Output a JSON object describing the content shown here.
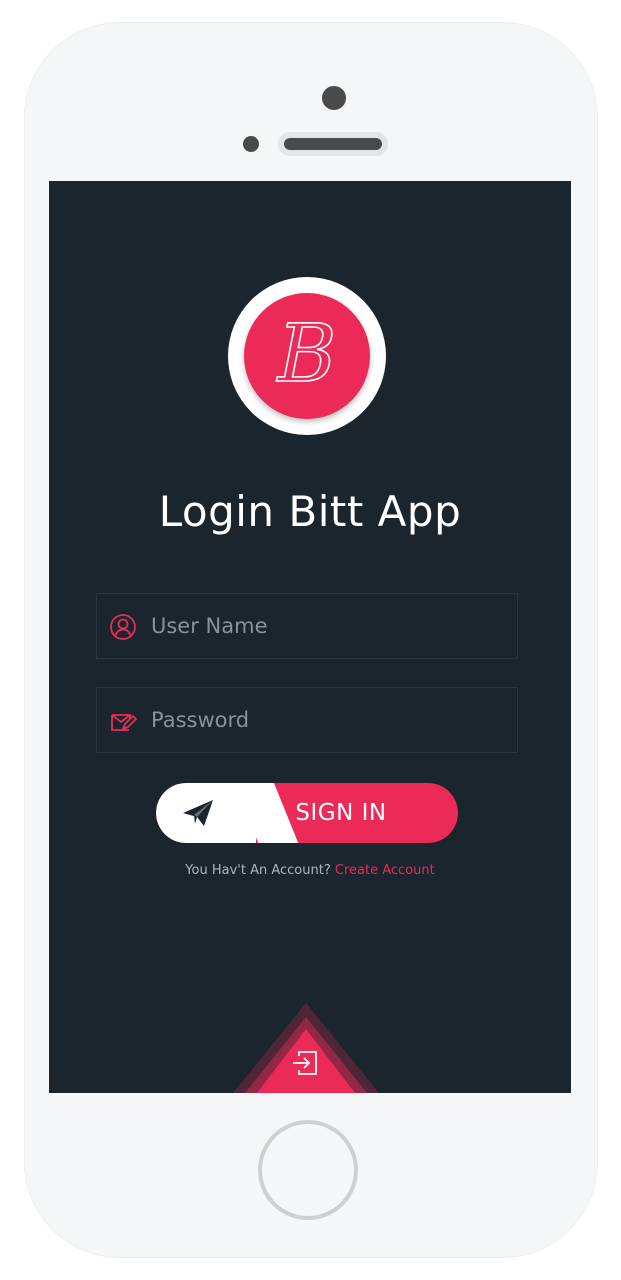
{
  "app": {
    "logo_letter": "B",
    "title": "Login Bitt App"
  },
  "form": {
    "username": {
      "placeholder": "User Name",
      "value": "",
      "icon": "user-icon"
    },
    "password": {
      "placeholder": "Password",
      "value": "",
      "icon": "edit-mail-icon"
    },
    "signin_label": "SIGN IN",
    "signin_icon": "paper-plane-icon"
  },
  "footer": {
    "question": "You Hav't An Account?",
    "create_link": "Create Account",
    "bottom_icon": "sign-in-icon"
  },
  "colors": {
    "accent": "#ec2a58",
    "background": "#1a252d",
    "device": "#f5f6f8"
  }
}
